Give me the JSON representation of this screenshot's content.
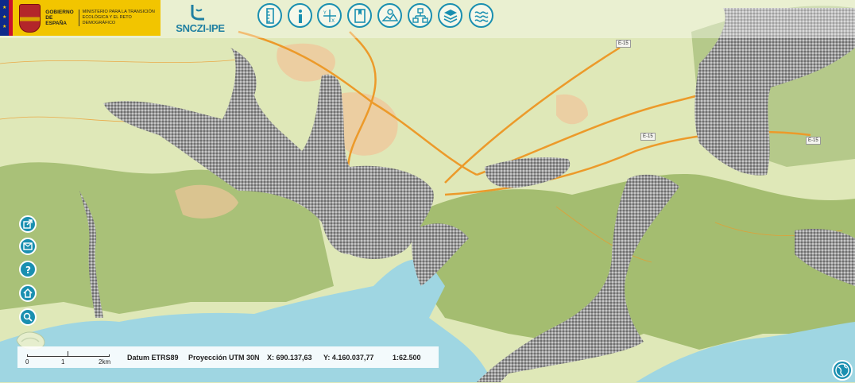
{
  "header": {
    "gov_title": "GOBIERNO DE ESPAÑA",
    "ministry": "MINISTERIO PARA LA TRANSICIÓN ECOLÓGICA Y EL RETO DEMOGRÁFICO",
    "app_name": "SNCZI-IPE"
  },
  "toolbar": {
    "tools": [
      {
        "name": "ruler-icon"
      },
      {
        "name": "info-icon"
      },
      {
        "name": "coordinates-icon"
      },
      {
        "name": "bookmark-icon"
      },
      {
        "name": "map-search-icon"
      },
      {
        "name": "layers-tree-icon"
      },
      {
        "name": "layers-stack-icon"
      },
      {
        "name": "water-waves-icon"
      }
    ]
  },
  "side_buttons": [
    {
      "name": "share-icon"
    },
    {
      "name": "mail-icon"
    },
    {
      "name": "help-icon"
    },
    {
      "name": "home-icon"
    },
    {
      "name": "zoom-icon"
    }
  ],
  "map": {
    "road_labels": [
      "E-15",
      "E-15",
      "E-15"
    ],
    "colors": {
      "land": "#dfe8b8",
      "hills": "#9db66a",
      "sea": "#9fd6e2",
      "urban": "#f0c59a",
      "flood_zone": "#8c8c8c",
      "roads": "#ec9a2a"
    }
  },
  "status": {
    "scale_labels": [
      "0",
      "1",
      "2km"
    ],
    "datum": "Datum ETRS89",
    "projection": "Proyección UTM 30N",
    "x_coord": "X: 690.137,63",
    "y_coord": "Y: 4.160.037,77",
    "scale": "1:62.500"
  }
}
